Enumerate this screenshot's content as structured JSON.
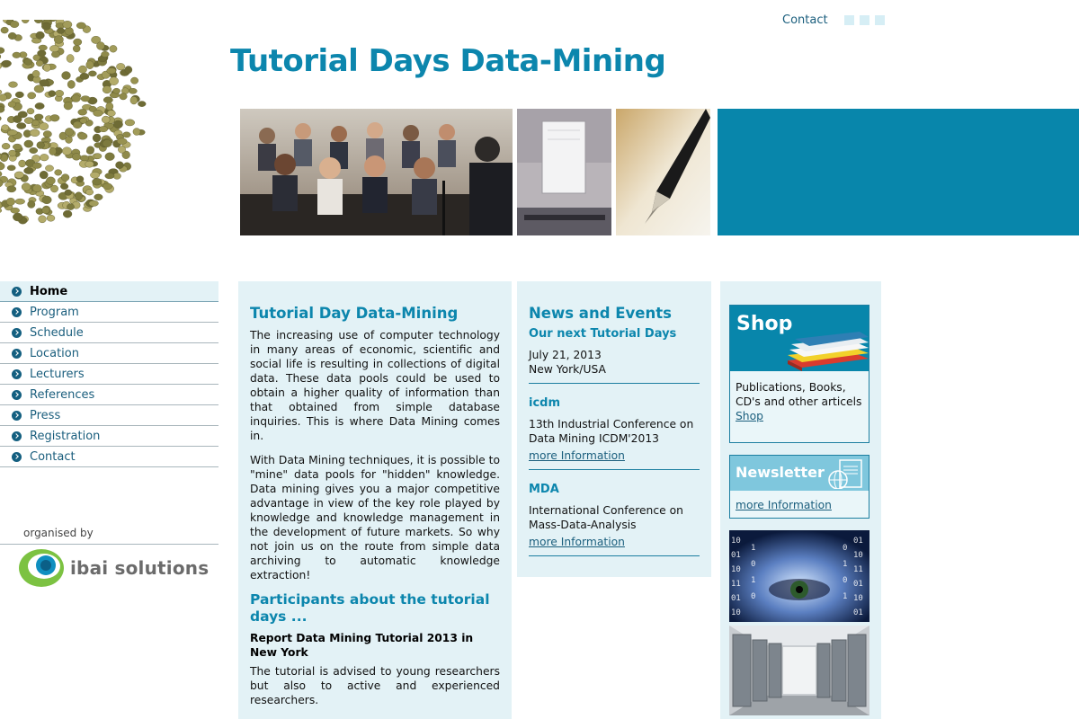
{
  "header": {
    "contact_label": "Contact",
    "site_title": "Tutorial Days Data-Mining"
  },
  "nav": {
    "items": [
      {
        "label": "Home",
        "active": true
      },
      {
        "label": "Program"
      },
      {
        "label": "Schedule"
      },
      {
        "label": "Location"
      },
      {
        "label": "Lecturers"
      },
      {
        "label": "References"
      },
      {
        "label": "Press"
      },
      {
        "label": "Registration"
      },
      {
        "label": "Contact"
      }
    ],
    "organised_by": "organised by",
    "org_name": "ibai solutions"
  },
  "main": {
    "title": "Tutorial Day Data-Mining",
    "paragraph1": "The increasing use of computer technology in many areas of economic, scientific and social life is resulting in collections of digital data. These data pools could be used to obtain a higher quality of information than that obtained from simple database inquiries. This is where Data Mining comes in.",
    "paragraph2": "With Data Mining techniques, it is possible to \"mine\" data pools for \"hidden\" knowledge. Data mining gives you a major competitive advantage in view of the key role played by knowledge and knowledge management in the development of future markets. So why not join us on the route from simple data archiving to automatic knowledge extraction!",
    "participants_heading": "Participants about the tutorial days ...",
    "report_title": "Report Data Mining Tutorial 2013 in New York",
    "report_text": "The tutorial is advised to young researchers but also to active and experienced researchers."
  },
  "news": {
    "title": "News and Events",
    "items": [
      {
        "head": "Our next Tutorial Days",
        "text": "July 21, 2013\nNew York/USA",
        "link": ""
      },
      {
        "head": "icdm",
        "text": "13th Industrial Conference on Data Mining ICDM'2013",
        "link": "more Information"
      },
      {
        "head": "MDA",
        "text": "International Conference on Mass-Data-Analysis",
        "link": "more Information"
      }
    ]
  },
  "sidebar": {
    "shop_title": "Shop",
    "shop_text": "Publications, Books, CD's and other articels",
    "shop_link": "Shop",
    "newsletter_title": "Newsletter",
    "newsletter_link": "more Information"
  },
  "colors": {
    "brand_blue": "#0886ab",
    "title_blue": "#0c86ad",
    "panel_bg": "#e3f2f6",
    "link": "#1a5e7d"
  },
  "icons": {
    "nav_bullet": "arrow-circle-icon",
    "newsletter": "newsletter-globe-icon",
    "logo": "ibai-logo-icon"
  }
}
